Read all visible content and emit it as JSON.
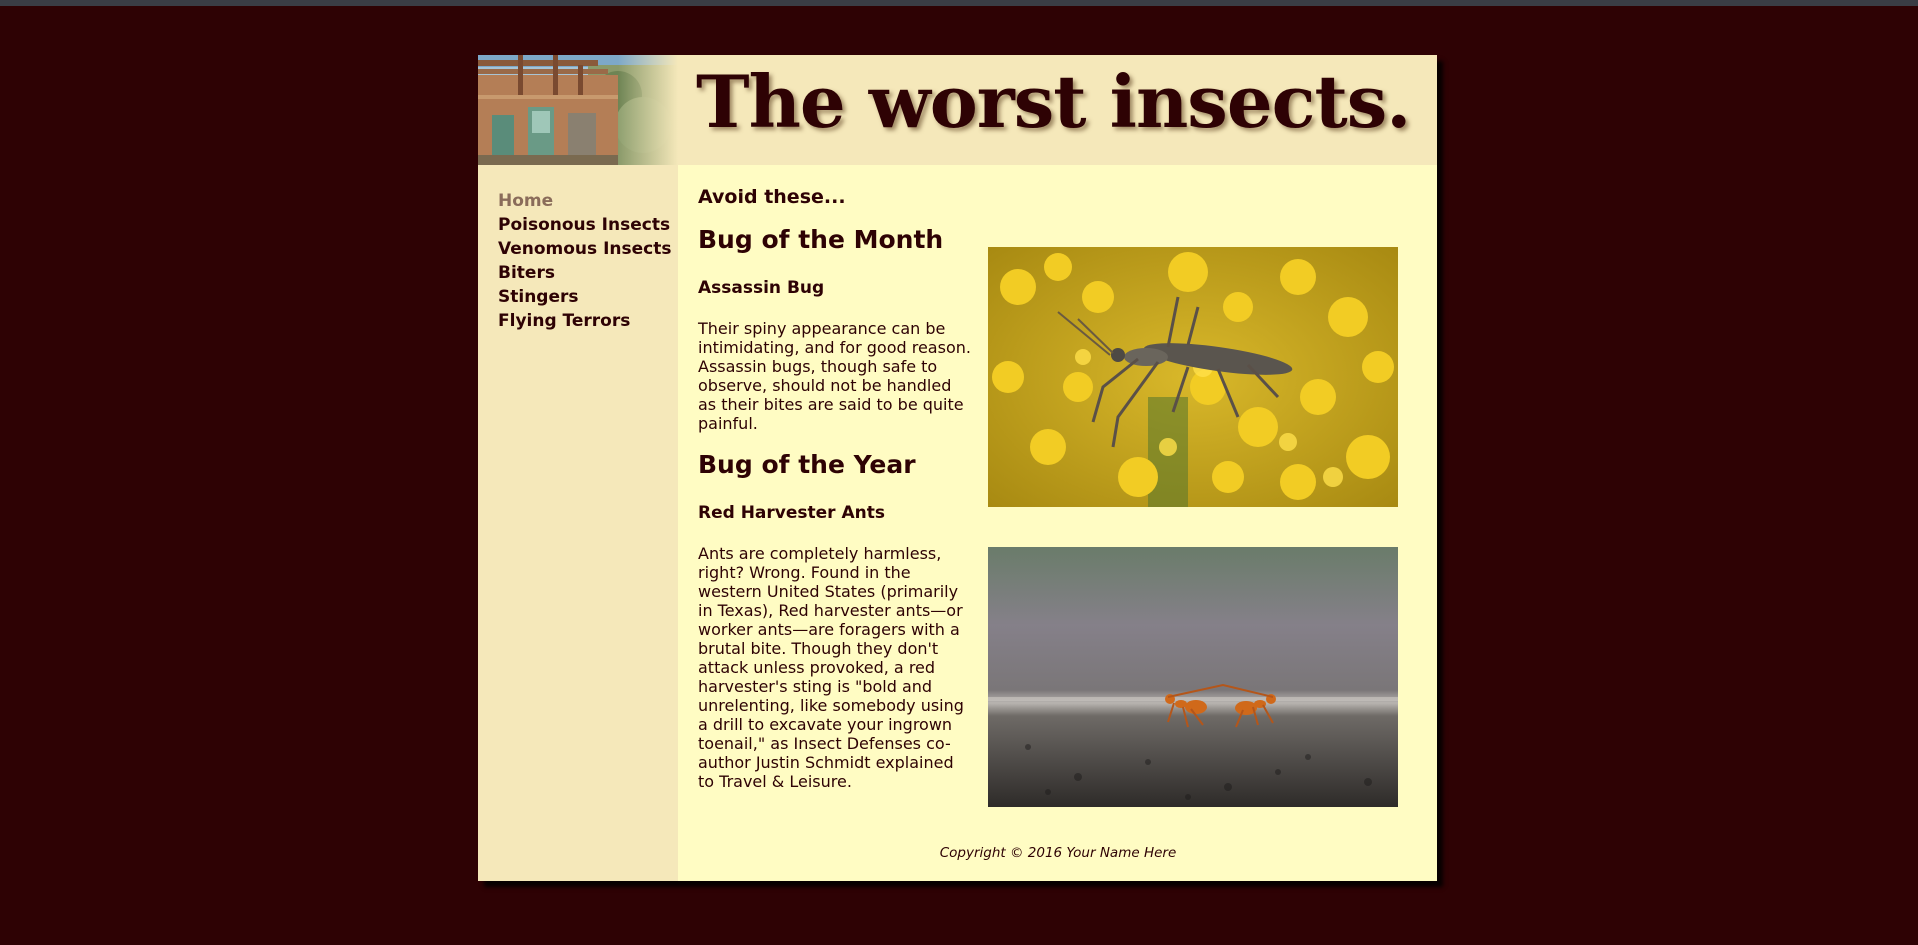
{
  "header": {
    "title": "The worst insects."
  },
  "nav": {
    "items": [
      "Home",
      "Poisonous Insects",
      "Venomous Insects",
      "Biters",
      "Stingers",
      "Flying Terrors"
    ],
    "active": "Home"
  },
  "main": {
    "intro": "Avoid these...",
    "month": {
      "heading": "Bug of the Month",
      "name": "Assassin Bug",
      "text": "Their spiny appearance can be intimidating, and for good reason. Assassin bugs, though safe to observe, should not be handled as their bites are said to be quite painful."
    },
    "year": {
      "heading": "Bug of the Year",
      "name": "Red Harvester Ants",
      "text": "Ants are completely harmless, right? Wrong. Found in the western United States (primarily in Texas), Red harvester ants—or worker ants—are foragers with a brutal bite. Though they don't attack unless provoked, a red harvester's sting is \"bold and unrelenting, like somebody using a drill to excavate your ingrown toenail,\" as Insect Defenses co-author Justin Schmidt explained to Travel & Leisure."
    }
  },
  "footer": {
    "copyright": "Copyright © 2016 Your Name Here"
  },
  "colors": {
    "background": "#2e0204",
    "page": "#fffcc3",
    "sidebar": "#f5e8ba",
    "text": "#2e0204",
    "active_nav": "#8a6c5a"
  }
}
